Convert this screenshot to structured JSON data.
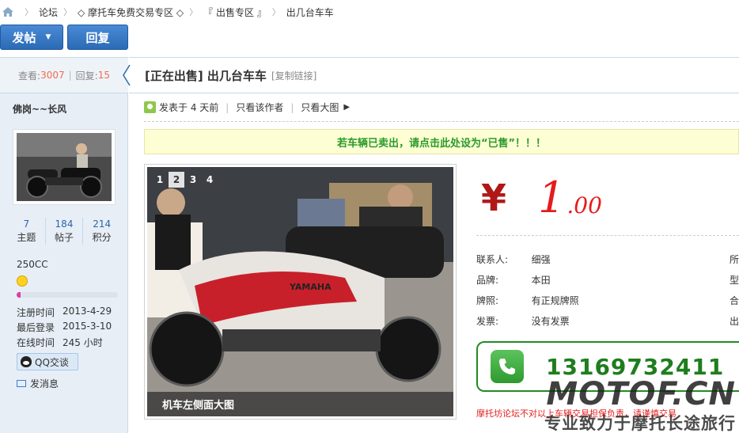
{
  "breadcrumb": {
    "items": [
      "论坛",
      "摩托车免费交易专区",
      "『 出售专区 』",
      "出几台车车"
    ]
  },
  "toolbar": {
    "post_label": "发帖",
    "reply_label": "回复"
  },
  "stats": {
    "views_label": "查看:",
    "views": "3007",
    "replies_label": "回复:",
    "replies": "15"
  },
  "author": {
    "name": "佛岗~~长风",
    "topics": "7",
    "topics_label": "主题",
    "posts": "184",
    "posts_label": "帖子",
    "points": "214",
    "points_label": "积分",
    "group": "250CC",
    "level_progress": 0.04,
    "register_label": "注册时间",
    "register_time": "2013-4-29",
    "last_login_label": "最后登录",
    "last_login": "2015-3-10",
    "online_label": "在线时间",
    "online_time": "245 小时",
    "qq_label": "QQ交谈",
    "message_label": "发消息"
  },
  "post": {
    "title": "[正在出售] 出几台车车",
    "copy_link": "[复制链接]",
    "posted_at": "发表于 4 天前",
    "only_author": "只看该作者",
    "big_image": "只看大图",
    "notice": "若车辆已卖出，请点击此处设为“已售”！！！"
  },
  "gallery": {
    "tabs": [
      "1",
      "2",
      "3",
      "4"
    ],
    "active_tab": 1,
    "caption": "机车左侧面大图"
  },
  "price": {
    "integer": "1",
    "decimal": ".00"
  },
  "specs": [
    {
      "key": "联系人:",
      "value": "细强",
      "extra": "所"
    },
    {
      "key": "品牌:",
      "value": "本田",
      "extra": "型"
    },
    {
      "key": "牌照:",
      "value": "有正规牌照",
      "extra": "合"
    },
    {
      "key": "发票:",
      "value": "没有发票",
      "extra": "出"
    }
  ],
  "contact": {
    "phone": "13169732411",
    "disclaimer": "摩托坊论坛不对以上车辆交易担保负责，请谨慎交易"
  },
  "watermark": {
    "brand": "MOTOF.CN",
    "slogan": "专业致力于摩托长途旅行"
  },
  "colors": {
    "accent_blue": "#2c6ab5",
    "price_red": "#e51c1c",
    "phone_green": "#1e7d1e",
    "notice_green": "#2a9b2a"
  }
}
